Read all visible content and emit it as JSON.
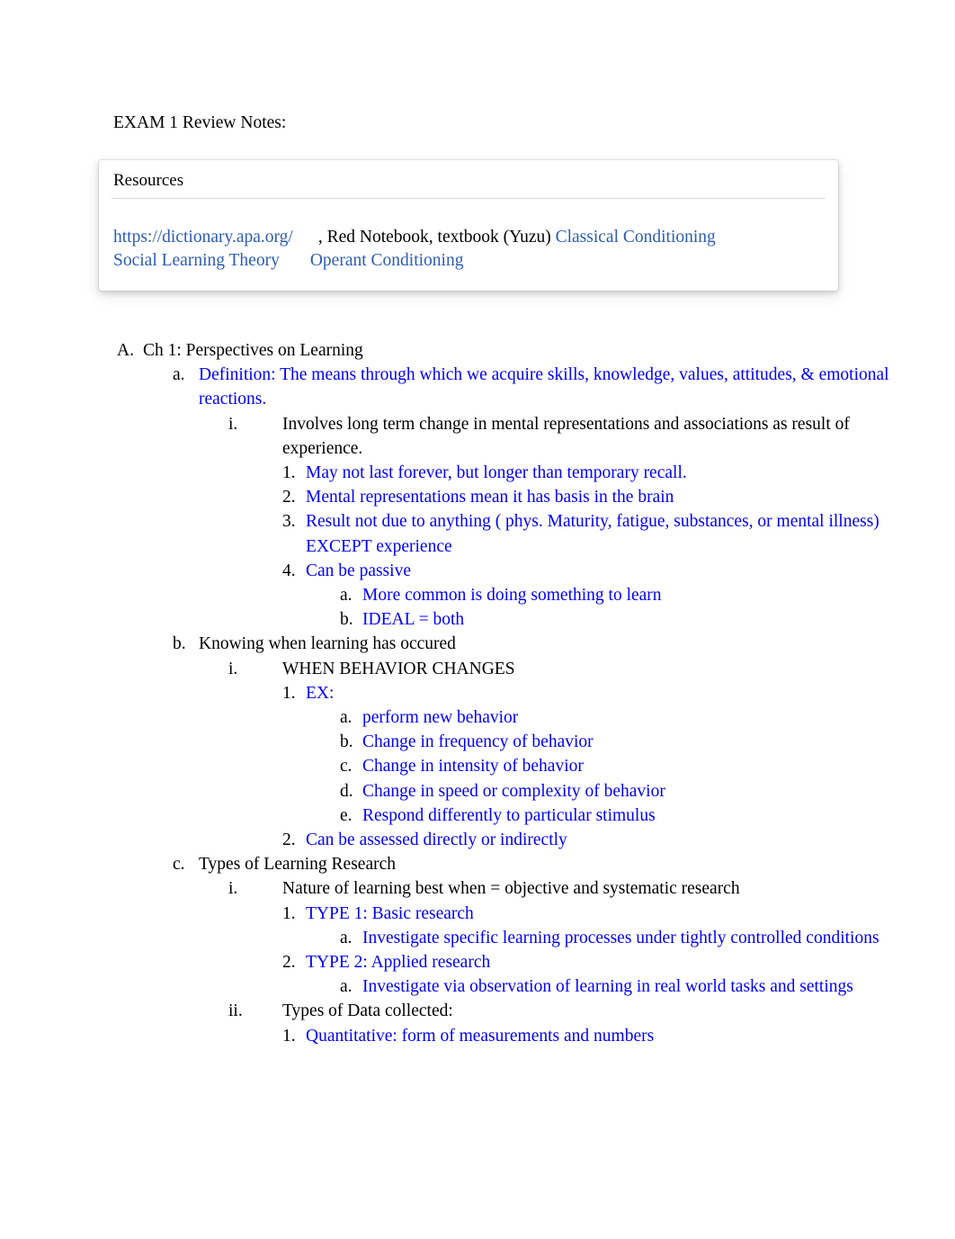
{
  "document": {
    "title": "EXAM 1 Review Notes:"
  },
  "resources": {
    "header": "Resources",
    "link_url_text": "https://dictionary.apa.org/",
    "plain_text": ", Red Notebook, textbook (Yuzu) ",
    "link_classical": "Classical Conditioning",
    "link_social": "Social Learning Theory",
    "link_operant": "Operant Conditioning"
  },
  "colors": {
    "body_blue": "#0000FF",
    "hyperlink_blue": "#2B5CB8",
    "text_black": "#000000",
    "divider_gray": "#D9D9D9"
  },
  "outline": {
    "A": {
      "marker": "A.",
      "text": "Ch 1: Perspectives on Learning",
      "color": "black"
    },
    "a": {
      "marker": "a.",
      "text": "Definition: The means through which we acquire skills, knowledge, values, attitudes, & emotional reactions.",
      "color": "blue"
    },
    "a_i": {
      "marker": "i.",
      "text": "Involves long term change in mental representations and associations as result of experience.",
      "color": "black"
    },
    "a_i_1": {
      "marker": "1.",
      "text": "May not last forever, but longer than temporary recall.",
      "color": "blue"
    },
    "a_i_2": {
      "marker": "2.",
      "text": "Mental representations mean it has basis in the brain",
      "color": "blue"
    },
    "a_i_3": {
      "marker": "3.",
      "text": "Result not due to anything ( phys. Maturity, fatigue, substances, or mental illness) EXCEPT experience",
      "color": "blue"
    },
    "a_i_4": {
      "marker": "4.",
      "text": "Can be passive",
      "color": "blue"
    },
    "a_i_4_a": {
      "marker": "a.",
      "text": "More common is doing something to learn",
      "color": "blue"
    },
    "a_i_4_b": {
      "marker": "b.",
      "text": "IDEAL = both",
      "color": "blue"
    },
    "b": {
      "marker": "b.",
      "text": "Knowing when learning has occured",
      "color": "black"
    },
    "b_i": {
      "marker": "i.",
      "text": "WHEN BEHAVIOR CHANGES",
      "color": "black"
    },
    "b_i_1": {
      "marker": "1.",
      "text": "EX:",
      "color": "blue"
    },
    "b_i_1_a": {
      "marker": "a.",
      "text": "perform new behavior",
      "color": "blue"
    },
    "b_i_1_b": {
      "marker": "b.",
      "text": "Change in frequency of behavior",
      "color": "blue"
    },
    "b_i_1_c": {
      "marker": "c.",
      "text": "Change in intensity of behavior",
      "color": "blue"
    },
    "b_i_1_d": {
      "marker": "d.",
      "text": "Change in speed or complexity of behavior",
      "color": "blue"
    },
    "b_i_1_e": {
      "marker": "e.",
      "text": "Respond differently to particular stimulus",
      "color": "blue"
    },
    "b_i_2": {
      "marker": "2.",
      "text": "Can be assessed directly or indirectly",
      "color": "blue"
    },
    "c": {
      "marker": "c.",
      "text": "Types of Learning Research",
      "color": "black"
    },
    "c_i": {
      "marker": "i.",
      "text": "Nature of learning best when = objective and systematic research",
      "color": "black"
    },
    "c_i_1": {
      "marker": "1.",
      "text": "TYPE 1: Basic research",
      "color": "blue"
    },
    "c_i_1_a": {
      "marker": "a.",
      "text": "Investigate specific learning processes under tightly controlled conditions",
      "color": "blue"
    },
    "c_i_2": {
      "marker": "2.",
      "text": "TYPE 2: Applied research",
      "color": "blue"
    },
    "c_i_2_a": {
      "marker": "a.",
      "text": "Investigate via observation of learning in real world tasks and settings",
      "color": "blue"
    },
    "c_ii": {
      "marker": "ii.",
      "text": "Types of Data collected:",
      "color": "black"
    },
    "c_ii_1": {
      "marker": "1.",
      "text": "Quantitative: form of measurements and numbers",
      "color": "blue"
    }
  }
}
